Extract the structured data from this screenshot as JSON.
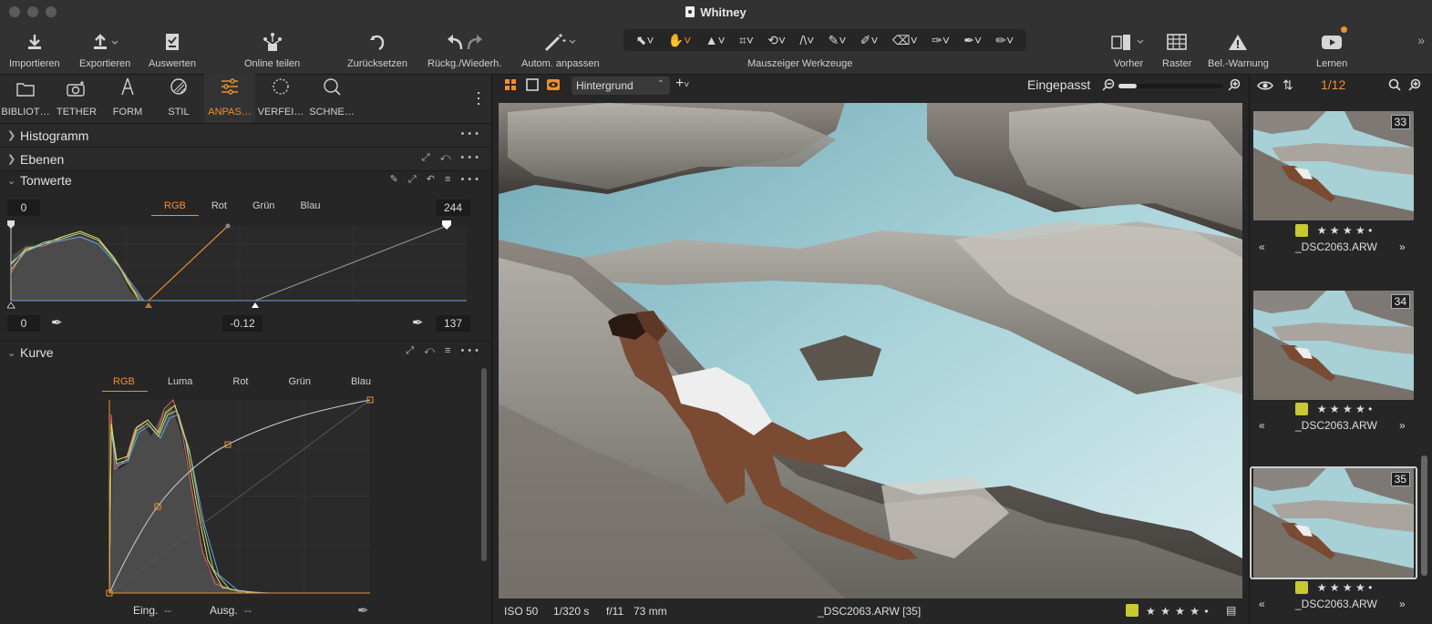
{
  "window": {
    "title": "Whitney"
  },
  "toolbar": {
    "import": "Importieren",
    "export": "Exportieren",
    "evaluate": "Auswerten",
    "share": "Online teilen",
    "reset": "Zurücksetzen",
    "undo_redo": "Rückg./Wiederh.",
    "auto_adjust": "Autom. anpassen",
    "cursor_tools": "Mauszeiger Werkzeuge",
    "before": "Vorher",
    "grid": "Raster",
    "exposure_warning": "Bel.-Warnung",
    "learn": "Lernen"
  },
  "tabs": [
    {
      "label": "BIBLIOT…",
      "icon": "folder-icon"
    },
    {
      "label": "TETHER",
      "icon": "camera-icon"
    },
    {
      "label": "FORM",
      "icon": "compass-icon"
    },
    {
      "label": "STIL",
      "icon": "style-icon"
    },
    {
      "label": "ANPAS…",
      "icon": "sliders-icon"
    },
    {
      "label": "VERFEI…",
      "icon": "refine-icon"
    },
    {
      "label": "SCHNE…",
      "icon": "search-icon"
    }
  ],
  "sections": {
    "histogram": "Histogramm",
    "layers": "Ebenen",
    "levels": "Tonwerte",
    "curve": "Kurve"
  },
  "levels": {
    "channels": [
      "RGB",
      "Rot",
      "Grün",
      "Blau"
    ],
    "active_channel": "RGB",
    "output_low": "0",
    "output_high": "244",
    "input_low": "0",
    "midtone": "-0.12",
    "input_high": "137"
  },
  "curve": {
    "channels": [
      "RGB",
      "Luma",
      "Rot",
      "Grün",
      "Blau"
    ],
    "active_channel": "RGB",
    "input_label": "Eing.",
    "input_value": "--",
    "output_label": "Ausg.",
    "output_value": "--"
  },
  "viewer": {
    "background": "Hintergrund",
    "zoom_label": "Eingepasst",
    "zoom_level": 0.17
  },
  "meta": {
    "iso": "ISO 50",
    "shutter": "1/320 s",
    "aperture": "f/11",
    "focal": "73 mm",
    "filename": "_DSC2063.ARW [35]",
    "stars": "★ ★ ★ ★ •",
    "color_tag": "#c8c832"
  },
  "browser": {
    "counter": "1/12",
    "thumbs": [
      {
        "num": "33",
        "name": "_DSC2063.ARW",
        "stars": "★ ★ ★ ★ •",
        "selected": false
      },
      {
        "num": "34",
        "name": "_DSC2063.ARW",
        "stars": "★ ★ ★ ★ •",
        "selected": false
      },
      {
        "num": "35",
        "name": "_DSC2063.ARW",
        "stars": "★ ★ ★ ★ •",
        "selected": true
      }
    ]
  },
  "colors": {
    "accent": "#f0902a",
    "panel": "#262626",
    "toolbar": "#323232"
  }
}
